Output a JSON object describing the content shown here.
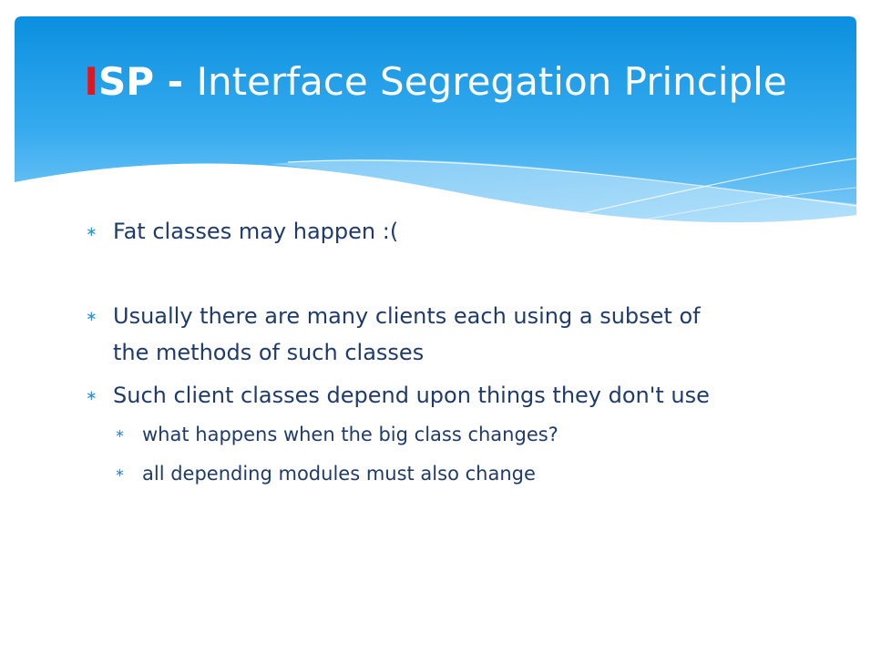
{
  "slide": {
    "title": {
      "acronym_first": "I",
      "acronym_rest": "SP",
      "separator": " - ",
      "text": "Interface Segregation Principle"
    },
    "bullets": [
      {
        "level": 1,
        "text": "Fat classes may happen :("
      },
      {
        "level": 1,
        "text": "Usually there are many clients each using a subset of",
        "continuation": "the methods of such classes"
      },
      {
        "level": 1,
        "text": "Such client classes depend upon things they don't use"
      },
      {
        "level": 2,
        "text": "what happens when the big class changes?"
      },
      {
        "level": 2,
        "text": "all depending modules must also change"
      }
    ],
    "bullet_glyph": "∗",
    "colors": {
      "title_accent": "#e8141c",
      "title_text": "#ffffff",
      "banner_top": "#0b8fdf",
      "banner_bottom": "#7fcaf6",
      "body_text": "#1f3b6b",
      "bullet": "#2e8fd6"
    }
  }
}
